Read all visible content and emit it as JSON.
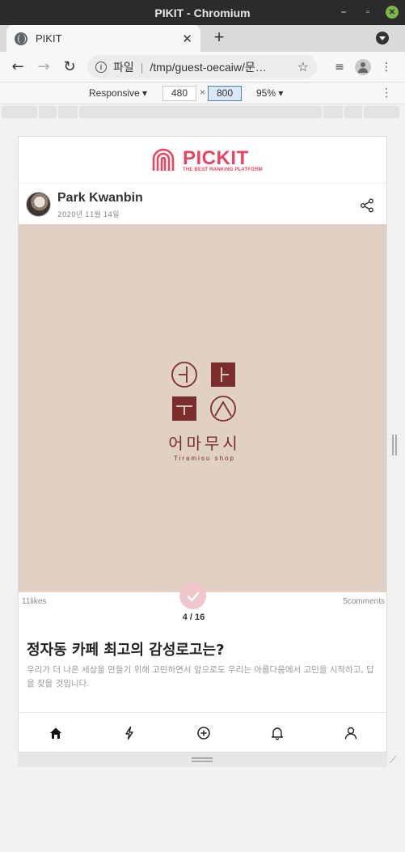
{
  "window": {
    "title": "PIKIT - Chromium"
  },
  "browser": {
    "tab_title": "PIKIT",
    "new_tab": "+",
    "url_scheme": "파일",
    "url_separator": "|",
    "url": "/tmp/guest-oecaiw/문…"
  },
  "devtools": {
    "device_mode": "Responsive",
    "width": "480",
    "times": "×",
    "height": "800",
    "zoom": "95%"
  },
  "app": {
    "logo_text": "PICKIT",
    "logo_tagline": "THE BEST RANKING PLATFORM",
    "brand_color": "#e94560"
  },
  "post": {
    "author": "Park Kwanbin",
    "date": "2020년 11월 14일",
    "image_bg": "#e0d1c4",
    "brand_logo_color": "#7a2e2e",
    "brand_name": "어마무시",
    "brand_sub": "Tiramisu shop",
    "likes": "11likes",
    "comments": "5comments",
    "page": "4 / 16",
    "title": "정자동 카페 최고의 감성로고는?",
    "body": "우리가 더 나은 세상을 만들기 위해 고민하면서 앞으로도 우리는 아름다움에서 고민을 시작하고, 답을 찾을 것입니다."
  },
  "nav": {
    "items": [
      "home-icon",
      "bolt-icon",
      "plus-circle-icon",
      "bell-icon",
      "user-icon"
    ]
  }
}
